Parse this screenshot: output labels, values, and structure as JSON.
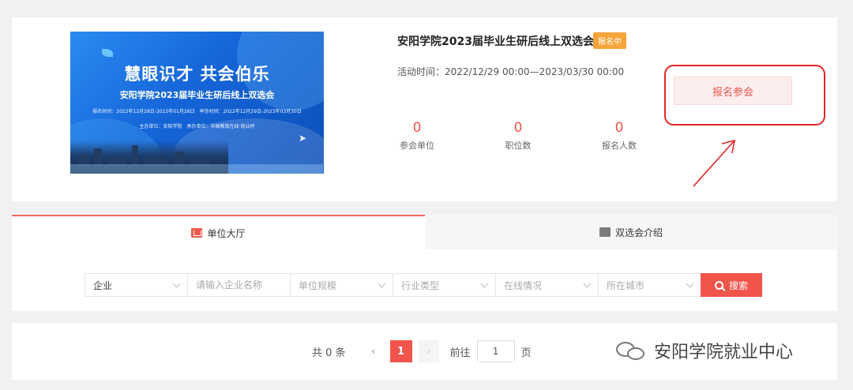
{
  "banner": {
    "slogan": "慧眼识才 共会伯乐",
    "subtitle": "安阳学院2023届毕业生研后线上双选会",
    "dates": "报名时间：2022年12月28日-2023年01月28日　举办时间：2022年12月29日-2023年03月30日",
    "organizers": "主办单位：安阳学院　承办单位：中国教育在线·就业桥"
  },
  "event": {
    "title": "安阳学院2023届毕业生研后线上双选会",
    "status_badge": "报名中",
    "time_text": "活动时间：2022/12/29 00:00—2023/03/30 00:00",
    "register_label": "报名参会",
    "stats": [
      {
        "value": "0",
        "label": "参会单位"
      },
      {
        "value": "0",
        "label": "职位数"
      },
      {
        "value": "0",
        "label": "报名人数"
      }
    ]
  },
  "tabs": [
    {
      "label": "单位大厅",
      "active": true
    },
    {
      "label": "双选会介绍",
      "active": false
    }
  ],
  "filters": {
    "type_value": "企业",
    "name_placeholder": "请输入企业名称",
    "scale_placeholder": "单位规模",
    "industry_placeholder": "行业类型",
    "online_placeholder": "在线情况",
    "city_placeholder": "所在城市",
    "search_label": "搜索"
  },
  "pagination": {
    "total_text": "共 0 条",
    "prev": "‹",
    "current_page": "1",
    "next": "›",
    "goto_label": "前往",
    "goto_value": "1",
    "page_suffix": "页"
  },
  "watermark": {
    "text": "安阳学院就业中心"
  },
  "colors": {
    "accent": "#f0544a",
    "badge": "#f7a43a",
    "annotation": "#e42424"
  }
}
